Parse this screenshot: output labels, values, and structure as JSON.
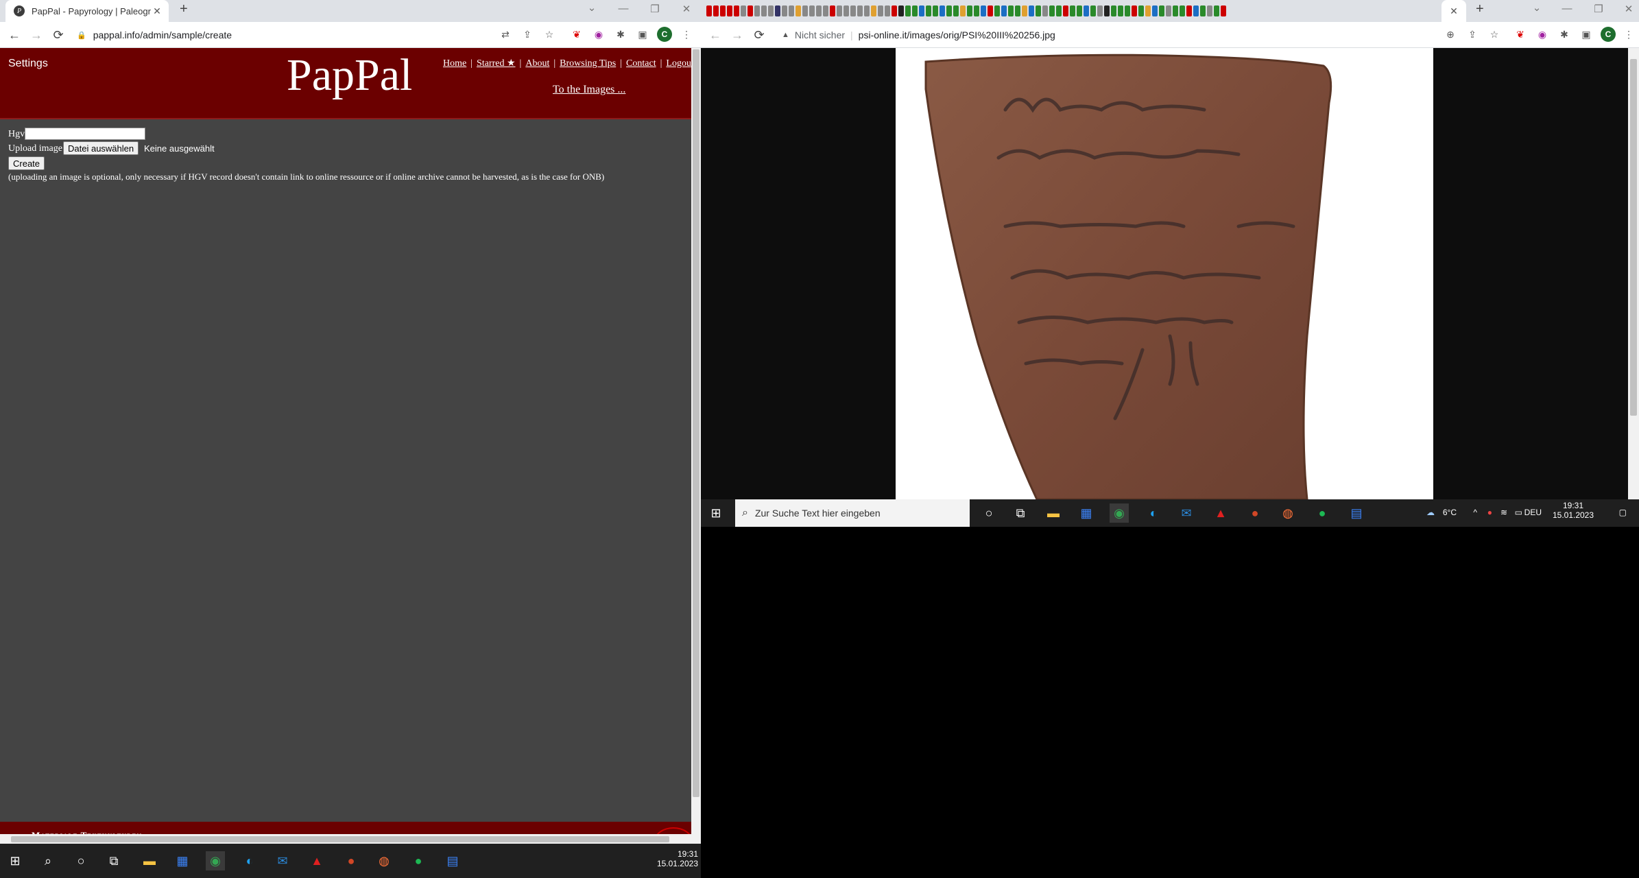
{
  "left": {
    "tab": {
      "favicon": "P",
      "title": "PapPal - Papyrology | Paleograph"
    },
    "url": "pappal.info/admin/sample/create",
    "site": {
      "settings": "Settings",
      "brand": "PapPal",
      "nav": [
        "Home",
        "Starred ★",
        "About",
        "Browsing Tips",
        "Contact",
        "Logou"
      ],
      "to_images": "To the Images ..."
    },
    "form": {
      "hgv_label": "Hgv",
      "hgv_value": "",
      "upload_label": "Upload image",
      "file_button": "Datei auswählen",
      "file_status": "Keine ausgewählt",
      "create_button": "Create",
      "note": "(uploading an image is optional, only necessary if HGV record doesn't contain link to online ressource or if online archive cannot be harvested, as is the case for ONB)"
    },
    "footer": "Materiale Textkulturen",
    "clock": {
      "time": "19:31",
      "date": "15.01.2023"
    }
  },
  "right": {
    "security": "Nicht sicher",
    "url": "psi-online.it/images/orig/PSI%20III%20256.jpg",
    "search_placeholder": "Zur Suche Text hier eingeben",
    "weather": "6°C",
    "lang": "DEU",
    "clock": {
      "time": "19:31",
      "date": "15.01.2023"
    }
  },
  "icons": {
    "back": "←",
    "forward": "→",
    "reload": "⟳",
    "lock": "🔒",
    "warning": "▲",
    "star": "☆",
    "close": "✕",
    "plus": "+",
    "minimize": "—",
    "restore": "❐",
    "chevron": "⌄",
    "windows": "⊞",
    "search": "⌕",
    "circle": "○",
    "avatar": "C"
  },
  "colors": {
    "banner": "#6b0000",
    "page": "#444444",
    "taskbar": "#202020"
  }
}
